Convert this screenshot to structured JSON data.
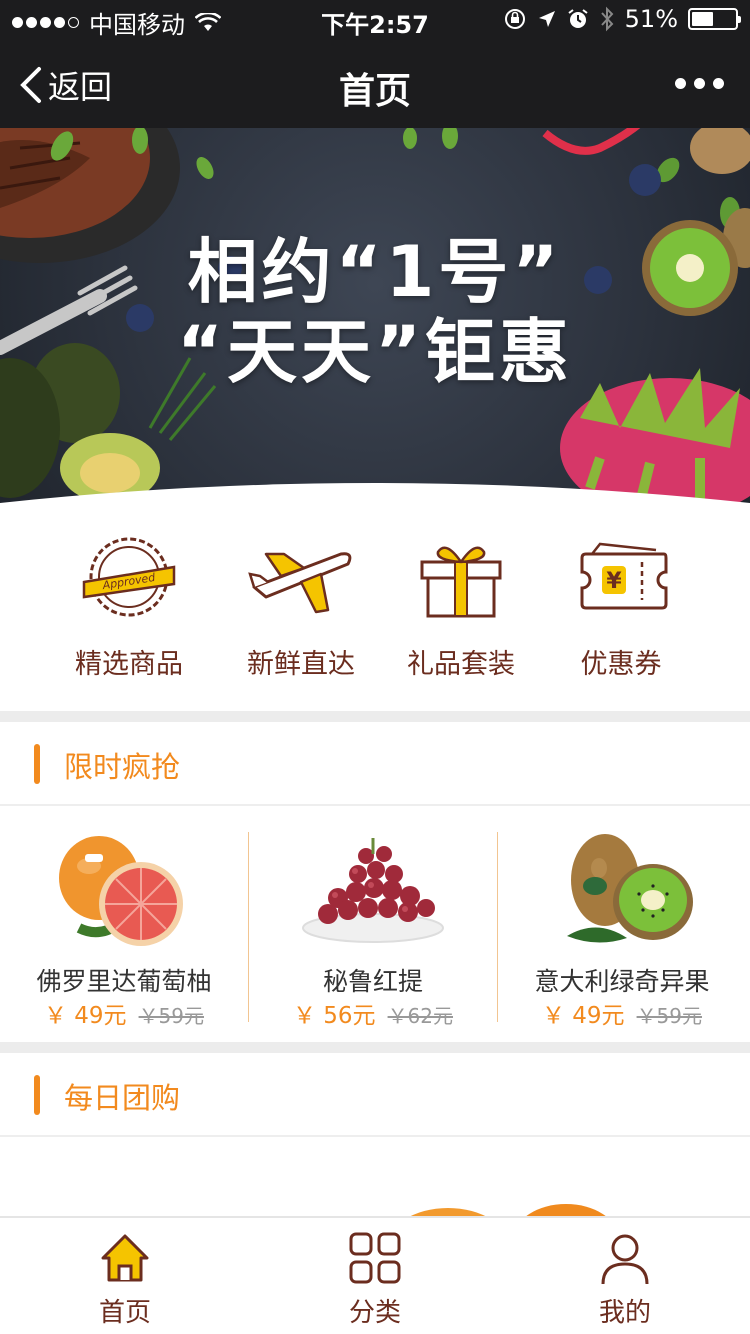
{
  "status_bar": {
    "carrier": "中国移动",
    "time": "下午2:57",
    "battery": "51%",
    "battery_level": 0.51
  },
  "nav": {
    "back_label": "返回",
    "title": "首页"
  },
  "banner": {
    "line1": "相约“1号”",
    "line2": "“天天”钜惠"
  },
  "categories": [
    {
      "label": "精选商品",
      "icon": "approved-badge-icon"
    },
    {
      "label": "新鲜直达",
      "icon": "airplane-icon"
    },
    {
      "label": "礼品套装",
      "icon": "gift-box-icon"
    },
    {
      "label": "优惠券",
      "icon": "coupon-icon"
    }
  ],
  "flash_sale": {
    "title": "限时疯抢",
    "products": [
      {
        "name": "佛罗里达葡萄柚",
        "price": "￥ 49元",
        "old_price": "￥59元",
        "image": "grapefruit"
      },
      {
        "name": "秘鲁红提",
        "price": "￥ 56元",
        "old_price": "￥62元",
        "image": "red-grapes"
      },
      {
        "name": "意大利绿奇异果",
        "price": "￥ 49元",
        "old_price": "￥59元",
        "image": "kiwi"
      }
    ]
  },
  "group_buy": {
    "title": "每日团购"
  },
  "tab_bar": [
    {
      "label": "首页",
      "icon": "home-icon",
      "active": true
    },
    {
      "label": "分类",
      "icon": "grid-icon",
      "active": false
    },
    {
      "label": "我的",
      "icon": "user-icon",
      "active": false
    }
  ],
  "colors": {
    "accent": "#f28a1e",
    "brand_brown": "#6b2d1f",
    "yellow": "#f5c400",
    "dark_bar": "#1c1c1e"
  }
}
